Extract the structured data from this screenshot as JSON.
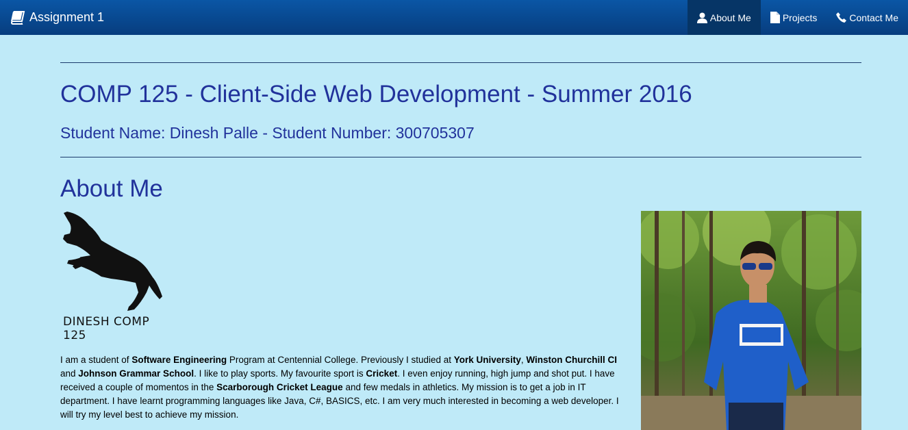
{
  "navbar": {
    "brand": "Assignment 1",
    "items": [
      {
        "label": "About Me",
        "icon": "user-icon",
        "active": true
      },
      {
        "label": "Projects",
        "icon": "file-icon",
        "active": false
      },
      {
        "label": "Contact Me",
        "icon": "phone-icon",
        "active": false
      }
    ]
  },
  "header": {
    "title": "COMP 125 - Client-Side Web Development - Summer 2016",
    "subtitle": "Student Name: Dinesh Palle - Student Number: 300705307"
  },
  "about": {
    "heading": "About Me",
    "logo_text": "DINESH COMP 125",
    "bio": [
      {
        "t": "I am a student of ",
        "b": false
      },
      {
        "t": "Software Engineering",
        "b": true
      },
      {
        "t": " Program at Centennial College. Previously I studied at ",
        "b": false
      },
      {
        "t": "York University",
        "b": true
      },
      {
        "t": ", ",
        "b": false
      },
      {
        "t": "Winston Churchill CI",
        "b": true
      },
      {
        "t": " and ",
        "b": false
      },
      {
        "t": "Johnson Grammar School",
        "b": true
      },
      {
        "t": ". I like to play sports. My favourite sport is ",
        "b": false
      },
      {
        "t": "Cricket",
        "b": true
      },
      {
        "t": ". I even enjoy running, high jump and shot put. I have received a couple of momentos in the ",
        "b": false
      },
      {
        "t": "Scarborough Cricket League",
        "b": true
      },
      {
        "t": " and few medals in athletics. My mission is to get a job in IT department. I have learnt programming languages like Java, C#, BASICS, etc. I am very much interested in becoming a web developer. I will try my level best to achieve my mission.",
        "b": false
      }
    ]
  },
  "colors": {
    "background": "#bfeaf8",
    "navbar": "#0a56a5",
    "heading": "#21329b"
  }
}
